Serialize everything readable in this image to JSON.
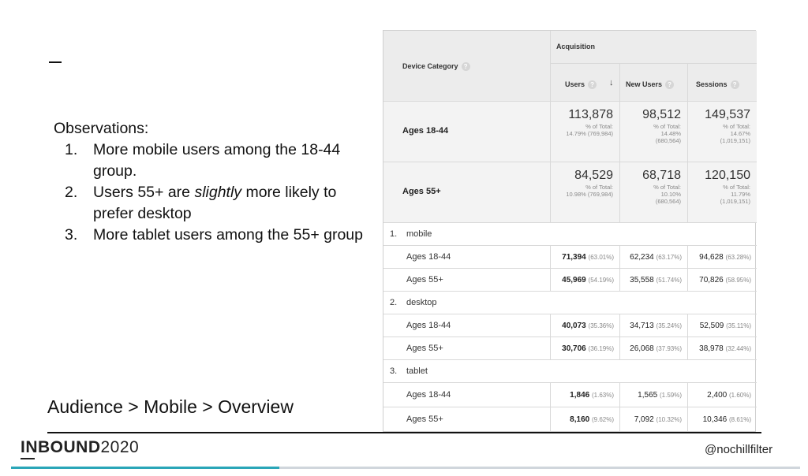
{
  "slide": {
    "dash": "—",
    "observations_title": "Observations:",
    "observations": [
      {
        "num": "1.",
        "text": "More mobile users among the 18-44 group."
      },
      {
        "num": "2.",
        "pre": "Users 55+ are ",
        "em": "slightly",
        "post": " more likely to prefer desktop"
      },
      {
        "num": "3.",
        "text": "More tablet users among the 55+ group"
      }
    ],
    "breadcrumb": "Audience > Mobile > Overview",
    "brand_bold": "INBOUND",
    "brand_light": "2020",
    "handle": "@nochillfilter"
  },
  "table": {
    "acquisition": "Acquisition",
    "device_category": "Device Category",
    "columns": [
      "Users",
      "New Users",
      "Sessions"
    ],
    "sort_arrow": "↓",
    "summary": [
      {
        "label": "Ages 18-44",
        "cells": [
          {
            "big": "113,878",
            "l1": "% of Total:",
            "l2": "14.79% (769,984)",
            "l3": ""
          },
          {
            "big": "98,512",
            "l1": "% of Total:",
            "l2": "14.48%",
            "l3": "(680,564)"
          },
          {
            "big": "149,537",
            "l1": "% of Total:",
            "l2": "14.67%",
            "l3": "(1,019,151)"
          }
        ]
      },
      {
        "label": "Ages 55+",
        "cells": [
          {
            "big": "84,529",
            "l1": "% of Total:",
            "l2": "10.98% (769,984)",
            "l3": ""
          },
          {
            "big": "68,718",
            "l1": "% of Total:",
            "l2": "10.10%",
            "l3": "(680,564)"
          },
          {
            "big": "120,150",
            "l1": "% of Total:",
            "l2": "11.79%",
            "l3": "(1,019,151)"
          }
        ]
      }
    ],
    "groups": [
      {
        "num": "1.",
        "name": "mobile",
        "rows": [
          {
            "label": "Ages 18-44",
            "vals": [
              {
                "v": "71,394",
                "p": "(63.01%)"
              },
              {
                "v": "62,234",
                "p": "(63.17%)"
              },
              {
                "v": "94,628",
                "p": "(63.28%)"
              }
            ]
          },
          {
            "label": "Ages 55+",
            "vals": [
              {
                "v": "45,969",
                "p": "(54.19%)"
              },
              {
                "v": "35,558",
                "p": "(51.74%)"
              },
              {
                "v": "70,826",
                "p": "(58.95%)"
              }
            ]
          }
        ]
      },
      {
        "num": "2.",
        "name": "desktop",
        "rows": [
          {
            "label": "Ages 18-44",
            "vals": [
              {
                "v": "40,073",
                "p": "(35.36%)"
              },
              {
                "v": "34,713",
                "p": "(35.24%)"
              },
              {
                "v": "52,509",
                "p": "(35.11%)"
              }
            ]
          },
          {
            "label": "Ages 55+",
            "vals": [
              {
                "v": "30,706",
                "p": "(36.19%)"
              },
              {
                "v": "26,068",
                "p": "(37.93%)"
              },
              {
                "v": "38,978",
                "p": "(32.44%)"
              }
            ]
          }
        ]
      },
      {
        "num": "3.",
        "name": "tablet",
        "rows": [
          {
            "label": "Ages 18-44",
            "vals": [
              {
                "v": "1,846",
                "p": "(1.63%)"
              },
              {
                "v": "1,565",
                "p": "(1.59%)"
              },
              {
                "v": "2,400",
                "p": "(1.60%)"
              }
            ]
          },
          {
            "label": "Ages 55+",
            "vals": [
              {
                "v": "8,160",
                "p": "(9.62%)"
              },
              {
                "v": "7,092",
                "p": "(10.32%)"
              },
              {
                "v": "10,346",
                "p": "(8.61%)"
              }
            ]
          }
        ]
      }
    ]
  },
  "colors": {
    "accent": "#2aa6b8",
    "header_bg": "#ececec"
  }
}
